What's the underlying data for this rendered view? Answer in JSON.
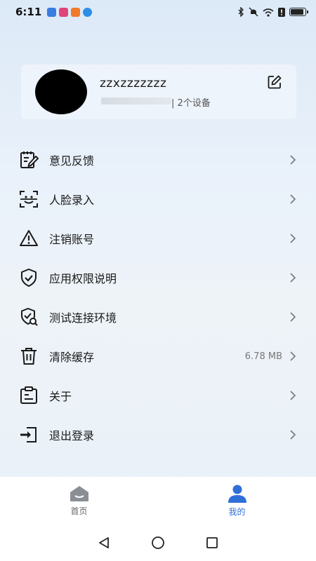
{
  "status_bar": {
    "time": "6:11"
  },
  "profile": {
    "username": "zzxzzzzzzz",
    "device_count": "| 2个设备"
  },
  "menu": {
    "items": [
      {
        "label": "意见反馈",
        "icon": "feedback-icon"
      },
      {
        "label": "人脸录入",
        "icon": "face-scan-icon"
      },
      {
        "label": "注销账号",
        "icon": "warning-icon"
      },
      {
        "label": "应用权限说明",
        "icon": "shield-check-icon"
      },
      {
        "label": "测试连接环境",
        "icon": "shield-search-icon"
      },
      {
        "label": "清除缓存",
        "icon": "trash-icon",
        "value": "6.78 MB"
      },
      {
        "label": "关于",
        "icon": "clipboard-icon"
      },
      {
        "label": "退出登录",
        "icon": "logout-icon"
      }
    ]
  },
  "bottom_nav": {
    "home_label": "首页",
    "mine_label": "我的",
    "active_color": "#2f6fd8"
  }
}
